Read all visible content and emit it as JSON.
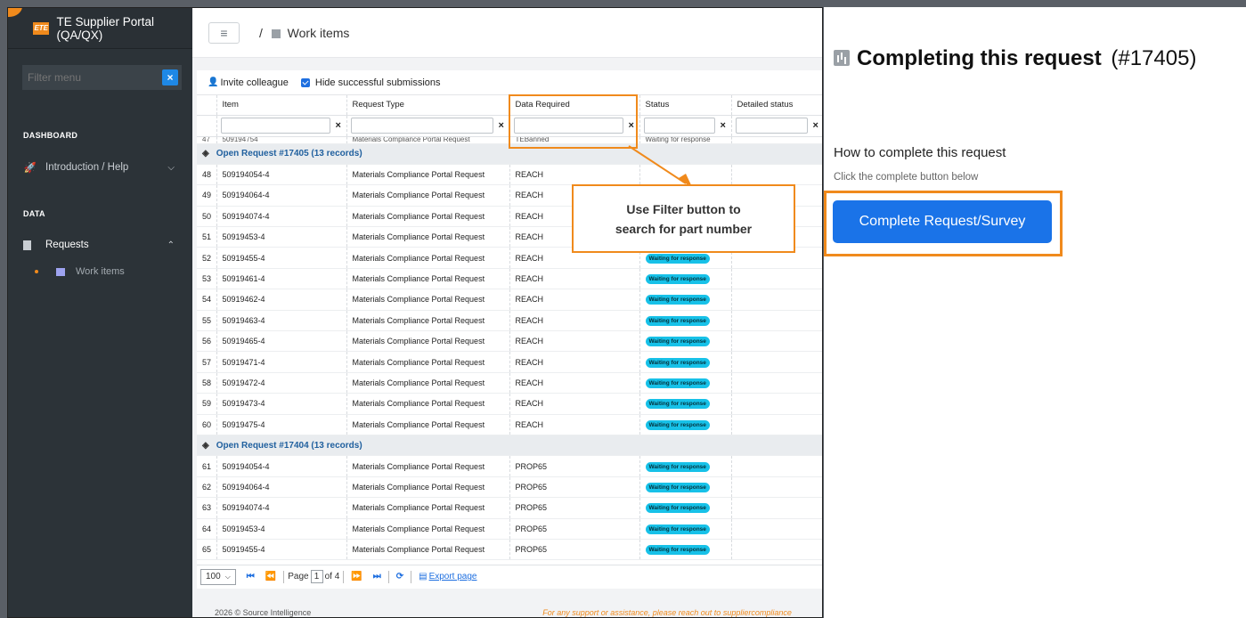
{
  "sidebar": {
    "brand_logo": "ETE",
    "brand_title": "TE Supplier Portal (QA/QX)",
    "filter_placeholder": "Filter menu",
    "sections": [
      {
        "label": "DASHBOARD"
      },
      {
        "label": "DATA"
      }
    ],
    "items": [
      {
        "label": "Introduction / Help",
        "icon": "rocket-icon"
      },
      {
        "label": "Requests",
        "icon": "document-icon"
      }
    ],
    "subitem": {
      "label": "Work items",
      "icon": "chart-icon"
    }
  },
  "header": {
    "breadcrumb_sep": "/",
    "breadcrumb": "Work items"
  },
  "toolbar": {
    "invite_label": "Invite colleague",
    "hide_label": "Hide successful submissions"
  },
  "table": {
    "columns": [
      "Item",
      "Request Type",
      "Data Required",
      "Status",
      "Detailed status"
    ],
    "cut_row": {
      "num": "47",
      "item": "509194754",
      "type": "Materials Compliance Portal Request",
      "data": "TEBanned",
      "status": "Waiting for response"
    },
    "groups": [
      {
        "title": "Open Request #17405 (13 records)",
        "rows": [
          {
            "num": "48",
            "item": "509194054-4",
            "type": "Materials Compliance Portal Request",
            "data": "REACH",
            "status": ""
          },
          {
            "num": "49",
            "item": "509194064-4",
            "type": "Materials Compliance Portal Request",
            "data": "REACH",
            "status": ""
          },
          {
            "num": "50",
            "item": "509194074-4",
            "type": "Materials Compliance Portal Request",
            "data": "REACH",
            "status": ""
          },
          {
            "num": "51",
            "item": "50919453-4",
            "type": "Materials Compliance Portal Request",
            "data": "REACH",
            "status": ""
          },
          {
            "num": "52",
            "item": "50919455-4",
            "type": "Materials Compliance Portal Request",
            "data": "REACH",
            "status": "Waiting for response"
          },
          {
            "num": "53",
            "item": "50919461-4",
            "type": "Materials Compliance Portal Request",
            "data": "REACH",
            "status": "Waiting for response"
          },
          {
            "num": "54",
            "item": "50919462-4",
            "type": "Materials Compliance Portal Request",
            "data": "REACH",
            "status": "Waiting for response"
          },
          {
            "num": "55",
            "item": "50919463-4",
            "type": "Materials Compliance Portal Request",
            "data": "REACH",
            "status": "Waiting for response"
          },
          {
            "num": "56",
            "item": "50919465-4",
            "type": "Materials Compliance Portal Request",
            "data": "REACH",
            "status": "Waiting for response"
          },
          {
            "num": "57",
            "item": "50919471-4",
            "type": "Materials Compliance Portal Request",
            "data": "REACH",
            "status": "Waiting for response"
          },
          {
            "num": "58",
            "item": "50919472-4",
            "type": "Materials Compliance Portal Request",
            "data": "REACH",
            "status": "Waiting for response"
          },
          {
            "num": "59",
            "item": "50919473-4",
            "type": "Materials Compliance Portal Request",
            "data": "REACH",
            "status": "Waiting for response"
          },
          {
            "num": "60",
            "item": "50919475-4",
            "type": "Materials Compliance Portal Request",
            "data": "REACH",
            "status": "Waiting for response"
          }
        ]
      },
      {
        "title": "Open Request #17404 (13 records)",
        "rows": [
          {
            "num": "61",
            "item": "509194054-4",
            "type": "Materials Compliance Portal Request",
            "data": "PROP65",
            "status": "Waiting for response"
          },
          {
            "num": "62",
            "item": "509194064-4",
            "type": "Materials Compliance Portal Request",
            "data": "PROP65",
            "status": "Waiting for response"
          },
          {
            "num": "63",
            "item": "509194074-4",
            "type": "Materials Compliance Portal Request",
            "data": "PROP65",
            "status": "Waiting for response"
          },
          {
            "num": "64",
            "item": "50919453-4",
            "type": "Materials Compliance Portal Request",
            "data": "PROP65",
            "status": "Waiting for response"
          },
          {
            "num": "65",
            "item": "50919455-4",
            "type": "Materials Compliance Portal Request",
            "data": "PROP65",
            "status": "Waiting for response"
          }
        ]
      }
    ]
  },
  "pager": {
    "page_size": "100",
    "page_label": "Page",
    "page_value": "1",
    "of_label": "of 4",
    "export_label": "Export page"
  },
  "footer": {
    "left": "2026 © Source Intelligence",
    "right": "For any support or assistance, please reach out to suppliercompliance"
  },
  "callout": {
    "line1": "Use Filter button to",
    "line2": "search for part number"
  },
  "right_panel": {
    "title": "Completing this request",
    "request_id": "(#17405)",
    "heading": "How to complete this request",
    "subtext": "Click the complete button below",
    "button_label": "Complete Request/Survey"
  },
  "colors": {
    "accent": "#f08a1c",
    "primary": "#1a73e8",
    "badge": "#17c1e8",
    "sidebar": "#2c3338"
  }
}
